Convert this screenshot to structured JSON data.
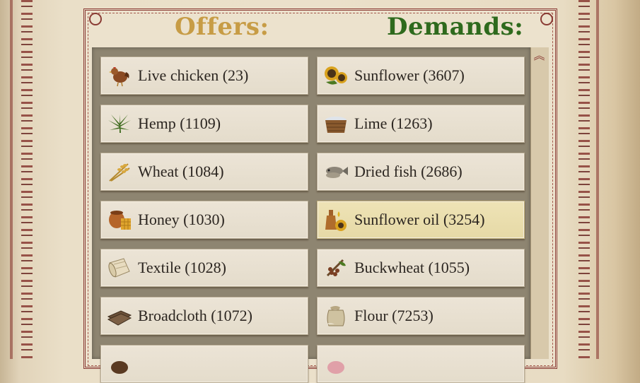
{
  "titles": {
    "offers": "Offers:",
    "demands": "Demands:"
  },
  "scroll": {
    "up_glyph": "︽"
  },
  "offers": [
    {
      "label": "Live chicken (23)",
      "icon": "chicken-icon"
    },
    {
      "label": "Hemp (1109)",
      "icon": "hemp-leaf-icon"
    },
    {
      "label": "Wheat (1084)",
      "icon": "wheat-icon"
    },
    {
      "label": "Honey (1030)",
      "icon": "honey-pot-icon"
    },
    {
      "label": "Textile (1028)",
      "icon": "textile-roll-icon"
    },
    {
      "label": "Broadcloth (1072)",
      "icon": "broadcloth-icon"
    },
    {
      "label": "",
      "icon": "partial-item-icon"
    }
  ],
  "demands": [
    {
      "label": "Sunflower (3607)",
      "icon": "sunflower-icon"
    },
    {
      "label": "Lime (1263)",
      "icon": "lime-basket-icon"
    },
    {
      "label": "Dried fish (2686)",
      "icon": "dried-fish-icon"
    },
    {
      "label": "Sunflower oil (3254)",
      "icon": "sunflower-oil-icon"
    },
    {
      "label": "Buckwheat (1055)",
      "icon": "buckwheat-icon"
    },
    {
      "label": "Flour (7253)",
      "icon": "flour-sack-icon"
    },
    {
      "label": "",
      "icon": "partial-item-icon"
    }
  ],
  "colors": {
    "offers_title": "#c79c45",
    "demands_title": "#2e6a1d",
    "highlight": "#eee3b6",
    "border_red": "#8a3b34"
  }
}
